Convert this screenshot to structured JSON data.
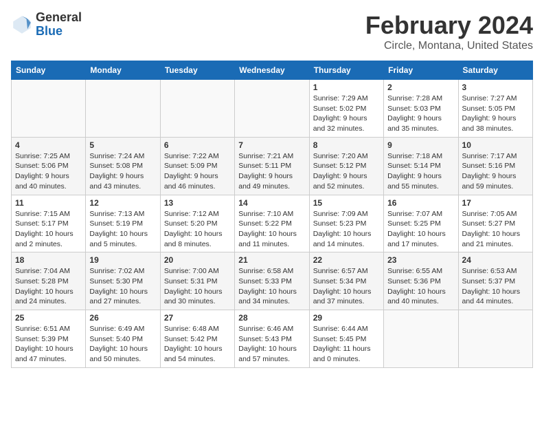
{
  "header": {
    "logo_general": "General",
    "logo_blue": "Blue",
    "title": "February 2024",
    "subtitle": "Circle, Montana, United States"
  },
  "calendar": {
    "days_of_week": [
      "Sunday",
      "Monday",
      "Tuesday",
      "Wednesday",
      "Thursday",
      "Friday",
      "Saturday"
    ],
    "weeks": [
      [
        {
          "day": "",
          "detail": ""
        },
        {
          "day": "",
          "detail": ""
        },
        {
          "day": "",
          "detail": ""
        },
        {
          "day": "",
          "detail": ""
        },
        {
          "day": "1",
          "detail": "Sunrise: 7:29 AM\nSunset: 5:02 PM\nDaylight: 9 hours and 32 minutes."
        },
        {
          "day": "2",
          "detail": "Sunrise: 7:28 AM\nSunset: 5:03 PM\nDaylight: 9 hours and 35 minutes."
        },
        {
          "day": "3",
          "detail": "Sunrise: 7:27 AM\nSunset: 5:05 PM\nDaylight: 9 hours and 38 minutes."
        }
      ],
      [
        {
          "day": "4",
          "detail": "Sunrise: 7:25 AM\nSunset: 5:06 PM\nDaylight: 9 hours and 40 minutes."
        },
        {
          "day": "5",
          "detail": "Sunrise: 7:24 AM\nSunset: 5:08 PM\nDaylight: 9 hours and 43 minutes."
        },
        {
          "day": "6",
          "detail": "Sunrise: 7:22 AM\nSunset: 5:09 PM\nDaylight: 9 hours and 46 minutes."
        },
        {
          "day": "7",
          "detail": "Sunrise: 7:21 AM\nSunset: 5:11 PM\nDaylight: 9 hours and 49 minutes."
        },
        {
          "day": "8",
          "detail": "Sunrise: 7:20 AM\nSunset: 5:12 PM\nDaylight: 9 hours and 52 minutes."
        },
        {
          "day": "9",
          "detail": "Sunrise: 7:18 AM\nSunset: 5:14 PM\nDaylight: 9 hours and 55 minutes."
        },
        {
          "day": "10",
          "detail": "Sunrise: 7:17 AM\nSunset: 5:16 PM\nDaylight: 9 hours and 59 minutes."
        }
      ],
      [
        {
          "day": "11",
          "detail": "Sunrise: 7:15 AM\nSunset: 5:17 PM\nDaylight: 10 hours and 2 minutes."
        },
        {
          "day": "12",
          "detail": "Sunrise: 7:13 AM\nSunset: 5:19 PM\nDaylight: 10 hours and 5 minutes."
        },
        {
          "day": "13",
          "detail": "Sunrise: 7:12 AM\nSunset: 5:20 PM\nDaylight: 10 hours and 8 minutes."
        },
        {
          "day": "14",
          "detail": "Sunrise: 7:10 AM\nSunset: 5:22 PM\nDaylight: 10 hours and 11 minutes."
        },
        {
          "day": "15",
          "detail": "Sunrise: 7:09 AM\nSunset: 5:23 PM\nDaylight: 10 hours and 14 minutes."
        },
        {
          "day": "16",
          "detail": "Sunrise: 7:07 AM\nSunset: 5:25 PM\nDaylight: 10 hours and 17 minutes."
        },
        {
          "day": "17",
          "detail": "Sunrise: 7:05 AM\nSunset: 5:27 PM\nDaylight: 10 hours and 21 minutes."
        }
      ],
      [
        {
          "day": "18",
          "detail": "Sunrise: 7:04 AM\nSunset: 5:28 PM\nDaylight: 10 hours and 24 minutes."
        },
        {
          "day": "19",
          "detail": "Sunrise: 7:02 AM\nSunset: 5:30 PM\nDaylight: 10 hours and 27 minutes."
        },
        {
          "day": "20",
          "detail": "Sunrise: 7:00 AM\nSunset: 5:31 PM\nDaylight: 10 hours and 30 minutes."
        },
        {
          "day": "21",
          "detail": "Sunrise: 6:58 AM\nSunset: 5:33 PM\nDaylight: 10 hours and 34 minutes."
        },
        {
          "day": "22",
          "detail": "Sunrise: 6:57 AM\nSunset: 5:34 PM\nDaylight: 10 hours and 37 minutes."
        },
        {
          "day": "23",
          "detail": "Sunrise: 6:55 AM\nSunset: 5:36 PM\nDaylight: 10 hours and 40 minutes."
        },
        {
          "day": "24",
          "detail": "Sunrise: 6:53 AM\nSunset: 5:37 PM\nDaylight: 10 hours and 44 minutes."
        }
      ],
      [
        {
          "day": "25",
          "detail": "Sunrise: 6:51 AM\nSunset: 5:39 PM\nDaylight: 10 hours and 47 minutes."
        },
        {
          "day": "26",
          "detail": "Sunrise: 6:49 AM\nSunset: 5:40 PM\nDaylight: 10 hours and 50 minutes."
        },
        {
          "day": "27",
          "detail": "Sunrise: 6:48 AM\nSunset: 5:42 PM\nDaylight: 10 hours and 54 minutes."
        },
        {
          "day": "28",
          "detail": "Sunrise: 6:46 AM\nSunset: 5:43 PM\nDaylight: 10 hours and 57 minutes."
        },
        {
          "day": "29",
          "detail": "Sunrise: 6:44 AM\nSunset: 5:45 PM\nDaylight: 11 hours and 0 minutes."
        },
        {
          "day": "",
          "detail": ""
        },
        {
          "day": "",
          "detail": ""
        }
      ]
    ]
  }
}
